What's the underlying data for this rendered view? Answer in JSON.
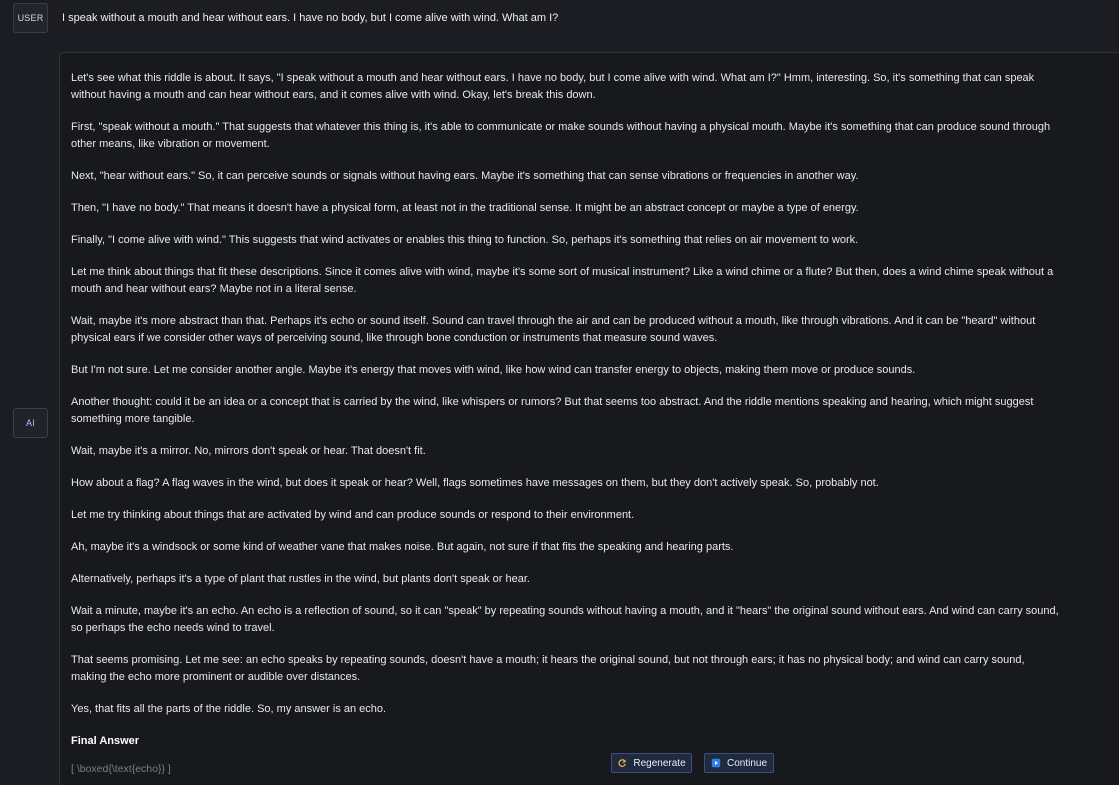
{
  "chat": {
    "user_label": "USER",
    "ai_label": "AI",
    "user_message": "I speak without a mouth and hear without ears. I have no body, but I come alive with wind. What am I?",
    "assistant": {
      "paragraphs": [
        "Let's see what this riddle is about. It says, \"I speak without a mouth and hear without ears. I have no body, but I come alive with wind. What am I?\" Hmm, interesting. So, it's something that can speak without having a mouth and can hear without ears, and it comes alive with wind. Okay, let's break this down.",
        "First, \"speak without a mouth.\" That suggests that whatever this thing is, it's able to communicate or make sounds without having a physical mouth. Maybe it's something that can produce sound through other means, like vibration or movement.",
        "Next, \"hear without ears.\" So, it can perceive sounds or signals without having ears. Maybe it's something that can sense vibrations or frequencies in another way.",
        "Then, \"I have no body.\" That means it doesn't have a physical form, at least not in the traditional sense. It might be an abstract concept or maybe a type of energy.",
        "Finally, \"I come alive with wind.\" This suggests that wind activates or enables this thing to function. So, perhaps it's something that relies on air movement to work.",
        "Let me think about things that fit these descriptions. Since it comes alive with wind, maybe it's some sort of musical instrument? Like a wind chime or a flute? But then, does a wind chime speak without a mouth and hear without ears? Maybe not in a literal sense.",
        "Wait, maybe it's more abstract than that. Perhaps it's echo or sound itself. Sound can travel through the air and can be produced without a mouth, like through vibrations. And it can be \"heard\" without physical ears if we consider other ways of perceiving sound, like through bone conduction or instruments that measure sound waves.",
        "But I'm not sure. Let me consider another angle. Maybe it's energy that moves with wind, like how wind can transfer energy to objects, making them move or produce sounds.",
        "Another thought: could it be an idea or a concept that is carried by the wind, like whispers or rumors? But that seems too abstract. And the riddle mentions speaking and hearing, which might suggest something more tangible.",
        "Wait, maybe it's a mirror. No, mirrors don't speak or hear. That doesn't fit.",
        "How about a flag? A flag waves in the wind, but does it speak or hear? Well, flags sometimes have messages on them, but they don't actively speak. So, probably not.",
        "Let me try thinking about things that are activated by wind and can produce sounds or respond to their environment.",
        "Ah, maybe it's a windsock or some kind of weather vane that makes noise. But again, not sure if that fits the speaking and hearing parts.",
        "Alternatively, perhaps it's a type of plant that rustles in the wind, but plants don't speak or hear.",
        "Wait a minute, maybe it's an echo. An echo is a reflection of sound, so it can \"speak\" by repeating sounds without having a mouth, and it \"hears\" the original sound without ears. And wind can carry sound, so perhaps the echo needs wind to travel.",
        "That seems promising. Let me see: an echo speaks by repeating sounds, doesn't have a mouth; it hears the original sound, but not through ears; it has no physical body; and wind can carry sound, making the echo more prominent or audible over distances.",
        "Yes, that fits all the parts of the riddle. So, my answer is an echo."
      ],
      "final_answer_title": "Final Answer",
      "final_answer_raw": "[ \\boxed{\\text{echo}} ]"
    }
  },
  "actions": {
    "regenerate_label": "Regenerate",
    "continue_label": "Continue"
  },
  "icons": {
    "regenerate": "refresh-icon",
    "continue": "play-icon"
  },
  "colors": {
    "background": "#1b1d22",
    "card_bg": "#17191d",
    "card_border": "#30333a",
    "button_border": "#3a4f7a",
    "accent": "#2f80ed"
  }
}
